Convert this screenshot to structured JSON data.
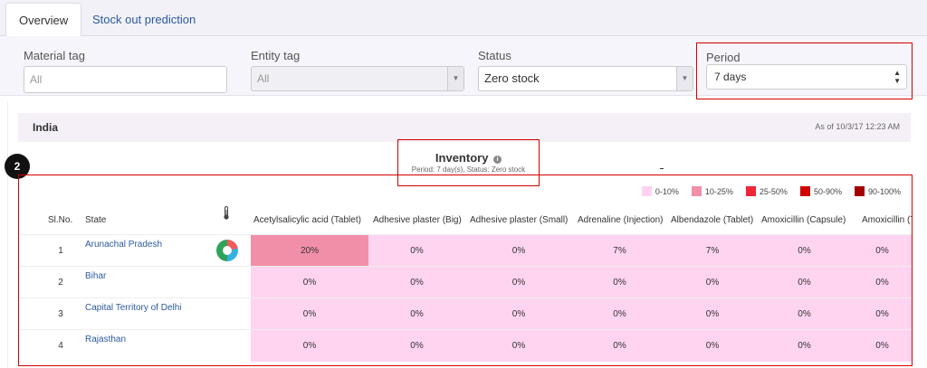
{
  "tabs": [
    "Overview",
    "Stock out prediction"
  ],
  "filters": {
    "material_tag": {
      "label": "Material tag",
      "placeholder": "All"
    },
    "entity_tag": {
      "label": "Entity tag",
      "value": "All"
    },
    "status": {
      "label": "Status",
      "value": "Zero stock"
    },
    "period": {
      "label": "Period",
      "value": "7 days"
    }
  },
  "region": {
    "name": "India",
    "as_of": "As of 10/3/17 12:23 AM"
  },
  "report": {
    "title": "Inventory",
    "subtitle": "Period: 7 day(s), Status: Zero stock"
  },
  "marker": "2",
  "legend": [
    {
      "label": "0-10%",
      "color": "#ffd4f0"
    },
    {
      "label": "10-25%",
      "color": "#f28fa8"
    },
    {
      "label": "25-50%",
      "color": "#f0263a"
    },
    {
      "label": "50-90%",
      "color": "#d00000"
    },
    {
      "label": "90-100%",
      "color": "#a30000"
    }
  ],
  "table": {
    "headers": {
      "sl": "Sl.No.",
      "state": "State"
    },
    "materials": [
      "Acetylsalicylic acid (Tablet)",
      "Adhesive plaster (Big)",
      "Adhesive plaster (Small)",
      "Adrenaline (Injection)",
      "Albendazole (Tablet)",
      "Amoxicillin (Capsule)",
      "Amoxicillin (Ta"
    ],
    "rows": [
      {
        "sl": "1",
        "state": "Arunachal Pradesh",
        "values": [
          "20%",
          "0%",
          "0%",
          "7%",
          "7%",
          "0%",
          "0%"
        ]
      },
      {
        "sl": "2",
        "state": "Bihar",
        "values": [
          "0%",
          "0%",
          "0%",
          "0%",
          "0%",
          "0%",
          "0%"
        ]
      },
      {
        "sl": "3",
        "state": "Capital Territory of Delhi",
        "values": [
          "0%",
          "0%",
          "0%",
          "0%",
          "0%",
          "0%",
          "0%"
        ]
      },
      {
        "sl": "4",
        "state": "Rajasthan",
        "values": [
          "0%",
          "0%",
          "0%",
          "0%",
          "0%",
          "0%",
          "0%"
        ]
      }
    ]
  }
}
